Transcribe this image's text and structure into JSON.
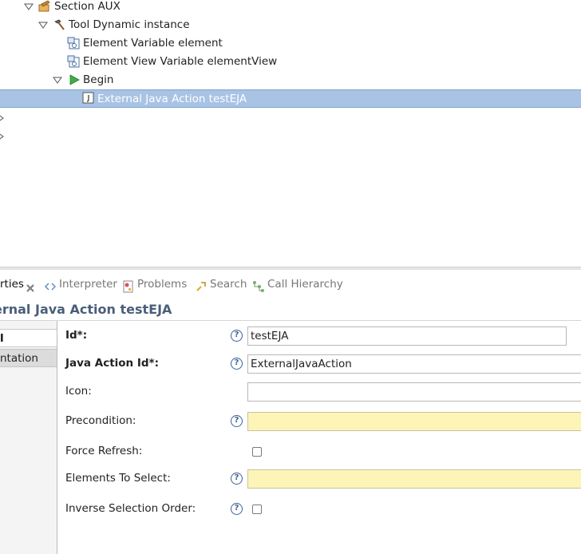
{
  "tree": {
    "section": "Section AUX",
    "tool": "Tool Dynamic instance",
    "var_element": "Element Variable element",
    "var_view": "Element View Variable elementView",
    "begin": "Begin",
    "action": "External Java Action testEJA"
  },
  "tabs": {
    "properties": "rties",
    "interpreter": "Interpreter",
    "problems": "Problems",
    "search": "Search",
    "call_hierarchy": "Call Hierarchy"
  },
  "view_title": "ernal Java Action testEJA",
  "left_tabs": {
    "general": "l",
    "documentation": "ntation"
  },
  "form": {
    "id_label": "Id*:",
    "id_value": "testEJA",
    "java_action_label": "Java Action Id*:",
    "java_action_value": "ExternalJavaAction",
    "icon_label": "Icon:",
    "icon_value": "",
    "precondition_label": "Precondition:",
    "precondition_value": "",
    "force_refresh_label": "Force Refresh:",
    "elements_label": "Elements To Select:",
    "elements_value": "",
    "inverse_label": "Inverse Selection Order:",
    "help_glyph": "?"
  },
  "colors": {
    "selection": "#a8c3e4",
    "title": "#4a5e7a",
    "required_field": "#fdf4b8",
    "help": "#3a5f96"
  }
}
